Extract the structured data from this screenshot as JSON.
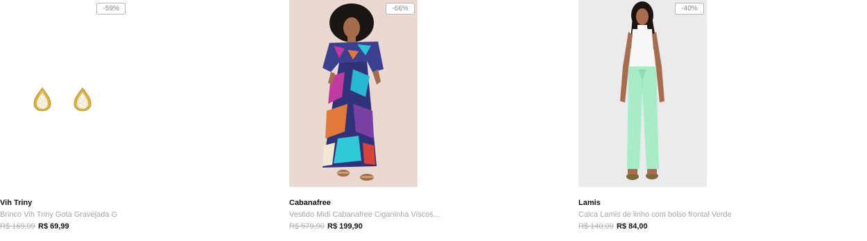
{
  "products": [
    {
      "brand": "Vih Triny",
      "name": "Brinco Vih Triny Gota Gravejada G",
      "old_price": "R$ 169,99",
      "new_price": "R$ 69,99",
      "discount": "-59%",
      "image_icon": "earrings-image"
    },
    {
      "brand": "Cabanafree",
      "name": "Vestido Midi Cabanafree Ciganinha Viscos...",
      "old_price": "R$ 579,90",
      "new_price": "R$ 199,90",
      "discount": "-66%",
      "image_icon": "dress-model-image"
    },
    {
      "brand": "Lamis",
      "name": "Calca Lamis de linho com bolso frontal Verde",
      "old_price": "R$ 140,00",
      "new_price": "R$ 84,00",
      "discount": "-40%",
      "image_icon": "pants-model-image"
    }
  ]
}
